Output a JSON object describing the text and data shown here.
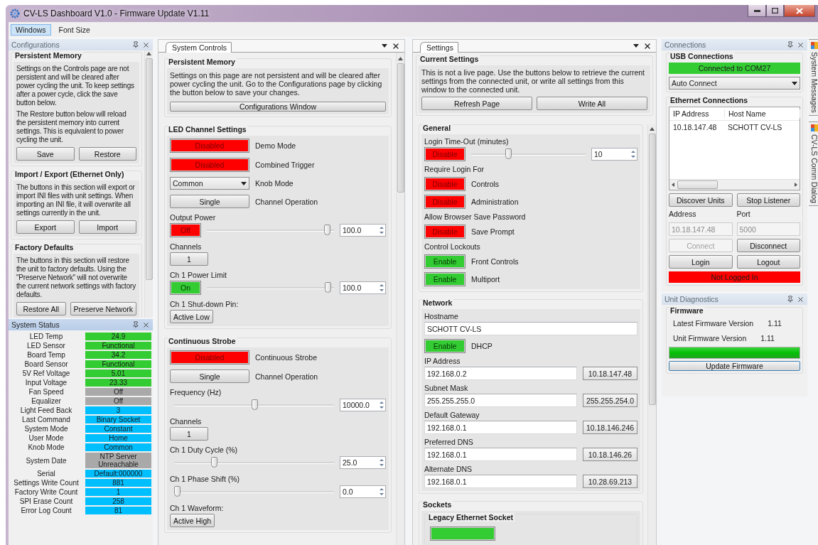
{
  "window": {
    "title": "CV-LS Dashboard V1.0 - Firmware Update V1.11"
  },
  "menu": [
    {
      "label": "Windows",
      "selected": true
    },
    {
      "label": "Font Size",
      "selected": false
    }
  ],
  "configurations": {
    "title": "Configurations",
    "sections": [
      {
        "title": "Persistent Memory",
        "paragraphs": [
          "Settings on the Controls page are not persistent and will be cleared after power cycling the unit. To keep settings after a power cycle, click the save button below.",
          "The Restore button below will reload the persistent memory into current settings. This is equivalent to power cycling the unit."
        ],
        "buttons": [
          "Save",
          "Restore"
        ]
      },
      {
        "title": "Import / Export (Ethernet Only)",
        "paragraphs": [
          "The buttons in this section will export or import INI files with unit settings. When importing an INI file, it will overwrite all settings currently in the unit."
        ],
        "buttons": [
          "Export",
          "Import"
        ]
      },
      {
        "title": "Factory Defaults",
        "paragraphs": [
          "The buttons in this section will restore the unit to factory defaults. Using the \"Preserve Network\" will not overwrite the current network settings with factory defaults."
        ],
        "buttons": [
          "Restore All",
          "Preserve Network"
        ]
      }
    ]
  },
  "system_status": {
    "title": "System Status",
    "rows": [
      {
        "label": "LED Temp",
        "value": "24.9",
        "color": "#33cc33"
      },
      {
        "label": "LED Sensor",
        "value": "Functional",
        "color": "#33cc33"
      },
      {
        "label": "Board Temp",
        "value": "34.2",
        "color": "#33cc33"
      },
      {
        "label": "Board Sensor",
        "value": "Functional",
        "color": "#33cc33"
      },
      {
        "label": "5V Ref Voltage",
        "value": "5.01",
        "color": "#33cc33"
      },
      {
        "label": "Input Voltage",
        "value": "23.33",
        "color": "#33cc33"
      },
      {
        "label": "Fan Speed",
        "value": "Off",
        "color": "#a9a9a9"
      },
      {
        "label": "Equalizer",
        "value": "Off",
        "color": "#a9a9a9"
      },
      {
        "label": "Light Feed Back",
        "value": "3",
        "color": "#00bfff"
      },
      {
        "label": "Last Command",
        "value": "Binary Socket",
        "color": "#00bfff"
      },
      {
        "label": "System Mode",
        "value": "Constant",
        "color": "#00bfff"
      },
      {
        "label": "User Mode",
        "value": "Home",
        "color": "#00bfff"
      },
      {
        "label": "Knob Mode",
        "value": "Common",
        "color": "#00bfff"
      },
      {
        "label": "System Date",
        "value": "NTP Server Unreachable",
        "color": "#a9a9a9"
      },
      {
        "label": "Serial",
        "value": "Default:000000",
        "color": "#00bfff"
      },
      {
        "label": "Settings Write Count",
        "value": "881",
        "color": "#00bfff"
      },
      {
        "label": "Factory Write Count",
        "value": "1",
        "color": "#00bfff"
      },
      {
        "label": "SPI Erase Count",
        "value": "258",
        "color": "#00bfff"
      },
      {
        "label": "Error Log Count",
        "value": "81",
        "color": "#00bfff"
      }
    ]
  },
  "system_controls": {
    "tab": "System Controls",
    "sections": [
      {
        "title": "Persistent Memory",
        "items": [
          {
            "kind": "note",
            "text": "Settings on this page are not persistent and will be cleared after power cycling the unit. Go to the Configurations page by clicking the button below to save your changes."
          },
          {
            "kind": "wide_button",
            "label": "Configurations Window"
          }
        ]
      },
      {
        "title": "LED Channel Settings",
        "items": [
          {
            "kind": "toggle",
            "label": "Disabled",
            "on": false,
            "caption": "Demo Mode"
          },
          {
            "kind": "toggle",
            "label": "Disabled",
            "on": false,
            "caption": "Combined Trigger"
          },
          {
            "kind": "dropdown",
            "value": "Common",
            "caption": "Knob Mode"
          },
          {
            "kind": "button",
            "label": "Single",
            "caption": "Channel Operation"
          },
          {
            "kind": "slider",
            "title": "Output Power",
            "toggle": {
              "label": "Off",
              "on": false
            },
            "level": 0.97,
            "value": "100.0"
          },
          {
            "kind": "small_button",
            "title": "Channels",
            "label": "1"
          },
          {
            "kind": "slider",
            "title": "Ch 1 Power Limit",
            "toggle": {
              "label": "On",
              "on": true
            },
            "level": 0.98,
            "value": "100.0"
          },
          {
            "kind": "small_button",
            "title": "Ch 1 Shut-down Pin:",
            "label": "Active Low"
          }
        ]
      },
      {
        "title": "Continuous Strobe",
        "items": [
          {
            "kind": "toggle",
            "label": "Disabled",
            "on": false,
            "caption": "Continuous Strobe"
          },
          {
            "kind": "button",
            "label": "Single",
            "caption": "Channel Operation"
          },
          {
            "kind": "slider",
            "title": "Frequency (Hz)",
            "level": 0.5,
            "value": "10000.0"
          },
          {
            "kind": "small_button",
            "title": "Channels",
            "label": "1"
          },
          {
            "kind": "slider",
            "title": "Ch 1 Duty Cycle (%)",
            "level": 0.25,
            "value": "25.0"
          },
          {
            "kind": "slider",
            "title": "Ch 1 Phase Shift (%)",
            "level": 0,
            "value": "0.0"
          },
          {
            "kind": "small_button",
            "title": "Ch 1 Waveform:",
            "label": "Active High"
          }
        ]
      }
    ]
  },
  "settings": {
    "tab": "Settings",
    "current": {
      "title": "Current Settings",
      "text": "This is not a live page. Use the buttons below to retrieve the current settings from the connected unit, or write all settings from this window to the connected unit.",
      "buttons": [
        "Refresh Page",
        "Write All"
      ]
    },
    "sections": [
      {
        "title": "General",
        "items": [
          {
            "kind": "slider",
            "title": "Login Time-Out (minutes)",
            "toggle": {
              "label": "Disable",
              "on": false
            },
            "level": 0.32,
            "value": "10"
          },
          {
            "kind": "label",
            "text": "Require Login For"
          },
          {
            "kind": "toggle",
            "label": "Disable",
            "on": false,
            "caption": "Controls"
          },
          {
            "kind": "toggle",
            "label": "Disable",
            "on": false,
            "caption": "Administration"
          },
          {
            "kind": "label",
            "text": "Allow Browser Save Password"
          },
          {
            "kind": "toggle",
            "label": "Disable",
            "on": false,
            "caption": "Save Prompt"
          },
          {
            "kind": "label",
            "text": "Control Lockouts"
          },
          {
            "kind": "toggle",
            "label": "Enable",
            "on": true,
            "caption": "Front Controls"
          },
          {
            "kind": "toggle",
            "label": "Enable",
            "on": true,
            "caption": "Multiport"
          }
        ]
      },
      {
        "title": "Network",
        "items": [
          {
            "kind": "field",
            "title": "Hostname",
            "value": "SCHOTT CV-LS"
          },
          {
            "kind": "toggle",
            "label": "Enable",
            "on": true,
            "caption": "DHCP"
          },
          {
            "kind": "ip_field",
            "title": "IP Address",
            "value": "192.168.0.2",
            "current": "10.18.147.48"
          },
          {
            "kind": "ip_field",
            "title": "Subnet Mask",
            "value": "255.255.255.0",
            "current": "255.255.254.0"
          },
          {
            "kind": "ip_field",
            "title": "Default Gateway",
            "value": "192.168.0.1",
            "current": "10.18.146.246"
          },
          {
            "kind": "ip_field",
            "title": "Preferred DNS",
            "value": "192.168.0.1",
            "current": "10.18.146.26"
          },
          {
            "kind": "ip_field",
            "title": "Alternate DNS",
            "value": "192.168.0.1",
            "current": "10.28.69.213"
          }
        ]
      },
      {
        "title": "Sockets",
        "items": [
          {
            "kind": "subgroup",
            "title": "Legacy Ethernet Socket",
            "on": true
          }
        ]
      }
    ]
  },
  "connections": {
    "title": "Connections",
    "usb": {
      "title": "USB Connections",
      "status": "Connected to COM27",
      "connected": true,
      "mode": "Auto Connect"
    },
    "ethernet": {
      "title": "Ethernet Connections",
      "columns": [
        "IP Address",
        "Host Name"
      ],
      "rows": [
        [
          "10.18.147.48",
          "SCHOTT CV-LS"
        ]
      ],
      "discover_buttons": [
        "Discover Units",
        "Stop Listener"
      ],
      "address": {
        "label": "Address",
        "value": "10.18.147.48",
        "disabled": true
      },
      "port": {
        "label": "Port",
        "value": "5000",
        "disabled": true
      },
      "connect_buttons": [
        {
          "label": "Connect",
          "disabled": true
        },
        {
          "label": "Disconnect",
          "disabled": false
        }
      ],
      "login_buttons": [
        "Login",
        "Logout"
      ],
      "login_status": {
        "text": "Not Logged In",
        "logged_in": false
      }
    }
  },
  "diagnostics": {
    "title": "Unit Diagnostics",
    "group": "Firmware",
    "rows": [
      {
        "label": "Latest Firmware Version",
        "value": "1.11"
      },
      {
        "label": "Unit Firmware Version",
        "value": "1.11"
      }
    ],
    "level": 1,
    "button": "Update Firmware"
  },
  "side_tabs": [
    "System Messages",
    "CV-LS Comm Dialog"
  ]
}
